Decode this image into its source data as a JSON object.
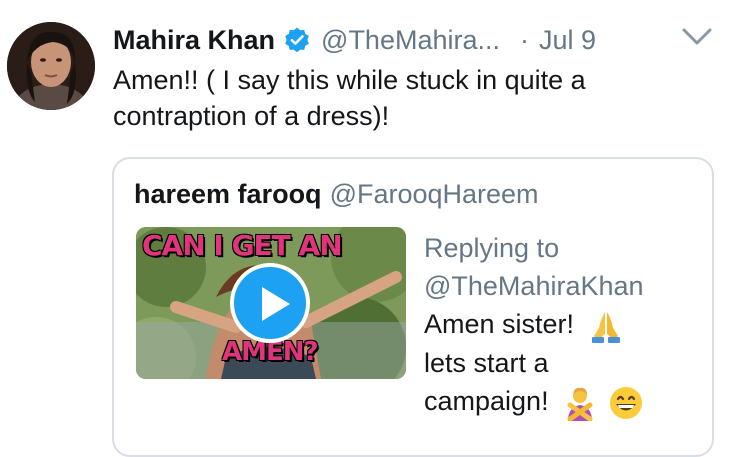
{
  "tweet": {
    "display_name": "Mahira Khan",
    "handle": "@TheMahira...",
    "separator": "·",
    "date": "Jul 9",
    "text_line1": "Amen!! ( I say this while stuck in quite a",
    "text_line2": "contraption of a dress)!",
    "verified_icon": "verified-badge-icon",
    "menu_icon": "chevron-down-icon",
    "accent_color": "#1da1f2"
  },
  "quoted_tweet": {
    "display_name": "hareem farooq",
    "handle": "@FarooqHareem",
    "replying_label": "Replying to",
    "replying_handle": "@TheMahiraKhan",
    "text_line1": "Amen sister!",
    "text_line2": "lets start a",
    "text_line3": "campaign!",
    "media": {
      "caption_top": "CAN I GET AN",
      "caption_bottom": "AMEN?",
      "play_icon": "play-icon"
    },
    "emojis": [
      "folded-hands-emoji",
      "person-gesturing-no-emoji",
      "grinning-face-emoji"
    ]
  }
}
